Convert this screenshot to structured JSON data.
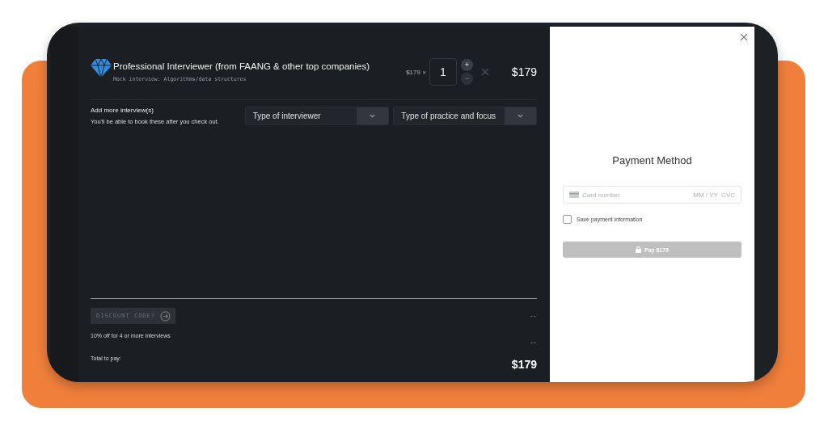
{
  "cart": {
    "item": {
      "title": "Professional Interviewer (from FAANG & other top companies)",
      "subtitle": "Mock interview: Algorithms/data structures",
      "unit_price": "$179 ×",
      "quantity": "1",
      "plus": "+",
      "minus": "−",
      "total": "$179"
    },
    "add_more": {
      "title": "Add more interview(s)",
      "note": "You'll be able to book these after you check out."
    },
    "selects": [
      {
        "placeholder": "Type of interviewer"
      },
      {
        "placeholder": "Type of practice and focus"
      }
    ],
    "discount": {
      "label": "DISCOUNT CODE?",
      "amount": "--"
    },
    "bulk": {
      "label": "10% off for 4 or more interviews",
      "amount": "--"
    },
    "total": {
      "label": "Total to pay:",
      "amount": "$179"
    }
  },
  "payment": {
    "title": "Payment Method",
    "card": {
      "placeholder": "Card number",
      "expiry_placeholder": "MM / YY  CVC"
    },
    "save": {
      "label": "Save payment information",
      "checked": false
    },
    "pay_button": {
      "label": "Pay $179",
      "disabled": true
    }
  }
}
